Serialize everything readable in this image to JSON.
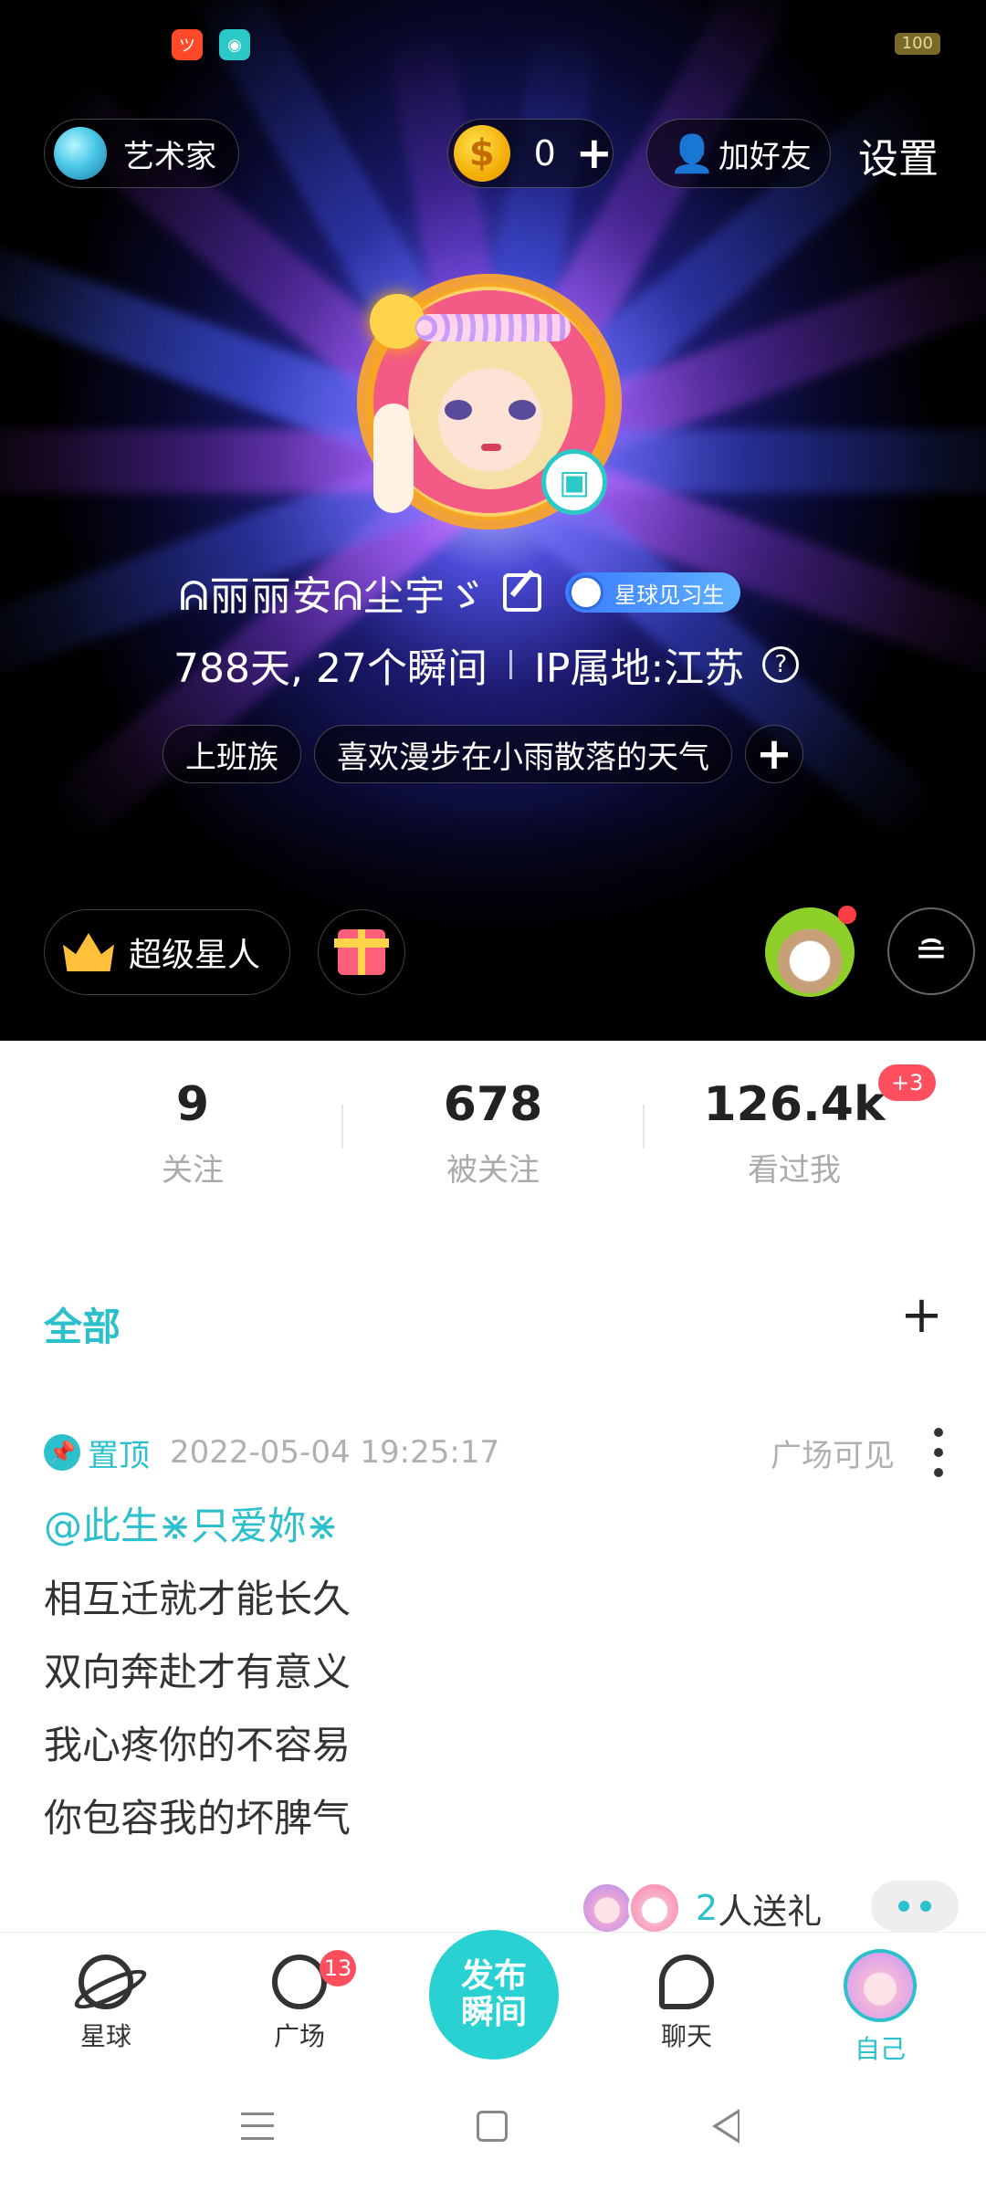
{
  "status_bar": {
    "battery": "100"
  },
  "top_bar": {
    "planet_name": "艺术家",
    "coins": "0",
    "add_friend_label": "加好友",
    "settings_label": "设置"
  },
  "profile": {
    "nickname": "ᕱ丽丽安ᕱ尘宇ゞ",
    "level_badge": "星球见习生",
    "days_moments": "788天, 27个瞬间",
    "ip_location": "IP属地:江苏",
    "tags": [
      "上班族",
      "喜欢漫步在小雨散落的天气"
    ],
    "vip_label": "超级星人"
  },
  "stats": [
    {
      "value": "9",
      "label": "关注"
    },
    {
      "value": "678",
      "label": "被关注"
    },
    {
      "value": "126.4k",
      "label": "看过我"
    }
  ],
  "stats_badge": "+3",
  "filter": {
    "label": "全部"
  },
  "post": {
    "pin_label": "置顶",
    "time": "2022-05-04 19:25:17",
    "visibility": "广场可见",
    "mention": "@此生⋇只爱妳⋇",
    "lines": [
      "相互迁就才能长久",
      "双向奔赴才有意义",
      "我心疼你的不容易",
      "你包容我的坏脾气"
    ],
    "gift_count": "2",
    "gift_text": "人送礼"
  },
  "bottom_nav": {
    "items": [
      {
        "label": "星球"
      },
      {
        "label": "广场",
        "badge": "13"
      },
      {
        "label": "发布瞬间",
        "line1": "发布",
        "line2": "瞬间"
      },
      {
        "label": "聊天"
      },
      {
        "label": "自己"
      }
    ]
  },
  "colors": {
    "accent": "#2CC0CC",
    "badge": "#FF4F5E",
    "publish": "#2AD1D3"
  }
}
